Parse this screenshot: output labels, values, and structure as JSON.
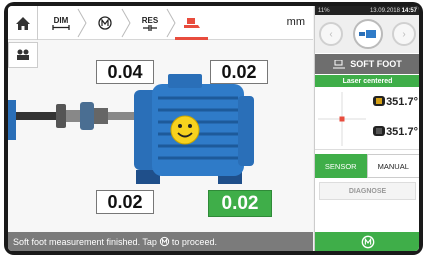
{
  "toolbar": {
    "dim_label": "DIM",
    "res_label": "RES",
    "unit": "mm"
  },
  "measurements": {
    "top_left": "0.04",
    "top_right": "0.02",
    "bottom_left": "0.02",
    "bottom_right": "0.02"
  },
  "status": {
    "message_before": "Soft foot measurement finished. Tap",
    "message_after": "to proceed."
  },
  "panel": {
    "battery": "11%",
    "datetime": "13.09.2018",
    "time": "14:57",
    "title": "SOFT FOOT",
    "laser_status": "Laser centered",
    "reading1": "351.7°",
    "reading2": "351.7°",
    "sensor_label": "SENSOR",
    "manual_label": "MANUAL",
    "diagnose_label": "DIAGNOSE"
  },
  "colors": {
    "accent_green": "#3fae49",
    "active_red": "#e84c3d",
    "motor_blue": "#2a6fb8"
  },
  "icons": [
    "home-icon",
    "dimensions-icon",
    "measure-icon",
    "results-icon",
    "softfoot-icon",
    "machine-icon",
    "proceed-icon"
  ]
}
